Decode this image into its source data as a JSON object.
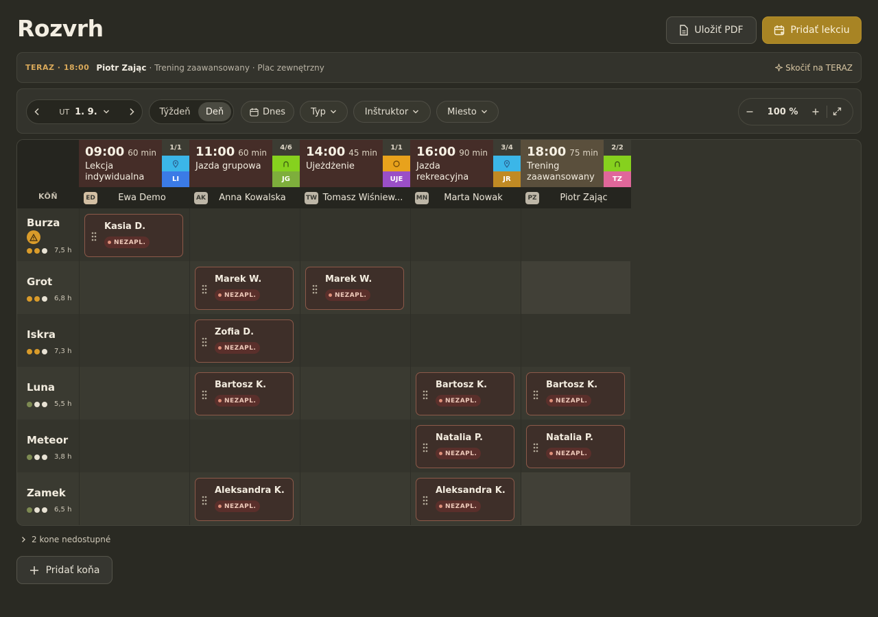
{
  "page": {
    "title": "Rozvrh"
  },
  "actions": {
    "pdf_label": "Uložiť PDF",
    "add_lesson_label": "Pridať lekciu"
  },
  "now": {
    "label": "TERAZ · 18:00",
    "name": "Piotr Zając",
    "details": "· Trening zaawansowany · Plac zewnętrzny",
    "jump_label": "Skočiť na TERAZ"
  },
  "toolbar": {
    "day_of_week": "UT",
    "date": "1. 9.",
    "view_week": "Týždeň",
    "view_day": "Deň",
    "today": "Dnes",
    "type": "Typ",
    "instructor": "Inštruktor",
    "place": "Miesto",
    "zoom": "100 %"
  },
  "grid": {
    "horse_header": "KÔŇ",
    "lessons": [
      {
        "time": "09:00",
        "duration": "60 min",
        "name": "Lekcja indywidualna",
        "count": "1/1",
        "icon": "location-pin-icon",
        "icon_color": "#3bb6e8",
        "code": "LI",
        "code_color": "#3b7be6",
        "instructor_initials": "ED",
        "instructor": "Ewa Demo"
      },
      {
        "time": "11:00",
        "duration": "60 min",
        "name": "Jazda grupowa",
        "count": "4/6",
        "icon": "horseshoe-icon",
        "icon_color": "#86d11e",
        "code": "JG",
        "code_color": "#7eae3c",
        "instructor_initials": "AK",
        "instructor": "Anna Kowalska"
      },
      {
        "time": "14:00",
        "duration": "45 min",
        "name": "Ujeżdżenie",
        "count": "1/1",
        "icon": "circle-icon",
        "icon_color": "#e8a21c",
        "code": "UJE",
        "code_color": "#9a4fc7",
        "instructor_initials": "TW",
        "instructor": "Tomasz Wiśniew..."
      },
      {
        "time": "16:00",
        "duration": "90 min",
        "name": "Jazda rekreacyjna",
        "count": "3/4",
        "icon": "location-pin-icon",
        "icon_color": "#3bb6e8",
        "code": "JR",
        "code_color": "#c08a24",
        "instructor_initials": "MN",
        "instructor": "Marta Nowak"
      },
      {
        "time": "18:00",
        "duration": "75 min",
        "name": "Trening zaawansowany",
        "count": "2/2",
        "icon": "horseshoe-icon",
        "icon_color": "#86d11e",
        "code": "TZ",
        "code_color": "#e0679a",
        "instructor_initials": "PZ",
        "instructor": "Piotr Zając"
      }
    ],
    "horses": [
      {
        "name": "Burza",
        "hours": "7,5 h",
        "warning": true,
        "level": [
          "#d99b2a",
          "#d99b2a",
          "#e8e2d4"
        ]
      },
      {
        "name": "Grot",
        "hours": "6,8 h",
        "warning": false,
        "level": [
          "#d99b2a",
          "#d99b2a",
          "#e8e2d4"
        ]
      },
      {
        "name": "Iskra",
        "hours": "7,3 h",
        "warning": false,
        "level": [
          "#d99b2a",
          "#d99b2a",
          "#e8e2d4"
        ]
      },
      {
        "name": "Luna",
        "hours": "5,5 h",
        "warning": false,
        "level": [
          "#7d8a52",
          "#e8e2d4",
          "#e8e2d4"
        ]
      },
      {
        "name": "Meteor",
        "hours": "3,8 h",
        "warning": false,
        "level": [
          "#7d8a52",
          "#e8e2d4",
          "#e8e2d4"
        ]
      },
      {
        "name": "Zamek",
        "hours": "6,5 h",
        "warning": false,
        "level": [
          "#7d8a52",
          "#e8e2d4",
          "#e8e2d4"
        ]
      }
    ],
    "badge_label": "NEZAPL.",
    "bookings": [
      {
        "row": 0,
        "col": 0,
        "rider": "Kasia D."
      },
      {
        "row": 1,
        "col": 1,
        "rider": "Marek W."
      },
      {
        "row": 1,
        "col": 2,
        "rider": "Marek W."
      },
      {
        "row": 2,
        "col": 1,
        "rider": "Zofia D."
      },
      {
        "row": 3,
        "col": 1,
        "rider": "Bartosz K."
      },
      {
        "row": 3,
        "col": 3,
        "rider": "Bartosz K."
      },
      {
        "row": 3,
        "col": 4,
        "rider": "Bartosz K."
      },
      {
        "row": 4,
        "col": 3,
        "rider": "Natalia P."
      },
      {
        "row": 4,
        "col": 4,
        "rider": "Natalia P."
      },
      {
        "row": 5,
        "col": 1,
        "rider": "Aleksandra K."
      },
      {
        "row": 5,
        "col": 3,
        "rider": "Aleksandra K."
      }
    ]
  },
  "footer": {
    "unavailable": "2 kone nedostupné",
    "add_horse": "Pridať koňa"
  }
}
